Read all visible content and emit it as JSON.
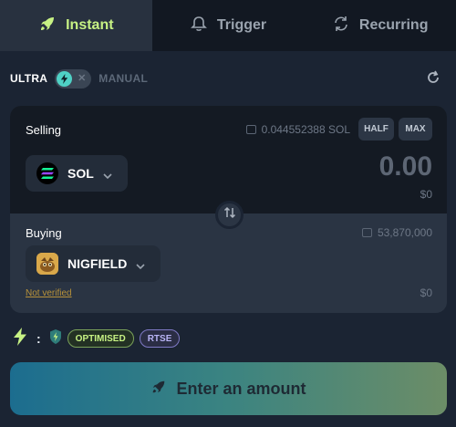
{
  "colors": {
    "accent": "#c7f284",
    "background": "#1b2433",
    "panel": "#2a3443",
    "selling_panel": "#141a23"
  },
  "tabs": [
    {
      "label": "Instant",
      "icon": "rocket-icon",
      "active": true
    },
    {
      "label": "Trigger",
      "icon": "bell-icon",
      "active": false
    },
    {
      "label": "Recurring",
      "icon": "refresh-cycle-icon",
      "active": false
    }
  ],
  "mode": {
    "ultra_label": "ULTRA",
    "manual_label": "MANUAL",
    "toggle_icon": "lightning-icon",
    "refresh_icon": "refresh-icon"
  },
  "selling": {
    "label": "Selling",
    "balance": "0.044552388 SOL",
    "half_label": "HALF",
    "max_label": "MAX",
    "token": "SOL",
    "amount": "0.00",
    "usd": "$0"
  },
  "buying": {
    "label": "Buying",
    "balance": "53,870,000",
    "token": "NIGFIELD",
    "verification": "Not verified",
    "usd": "$0"
  },
  "route": {
    "colon": ":",
    "badges": [
      "OPTIMISED",
      "RTSE"
    ]
  },
  "cta": {
    "label": "Enter an amount"
  }
}
